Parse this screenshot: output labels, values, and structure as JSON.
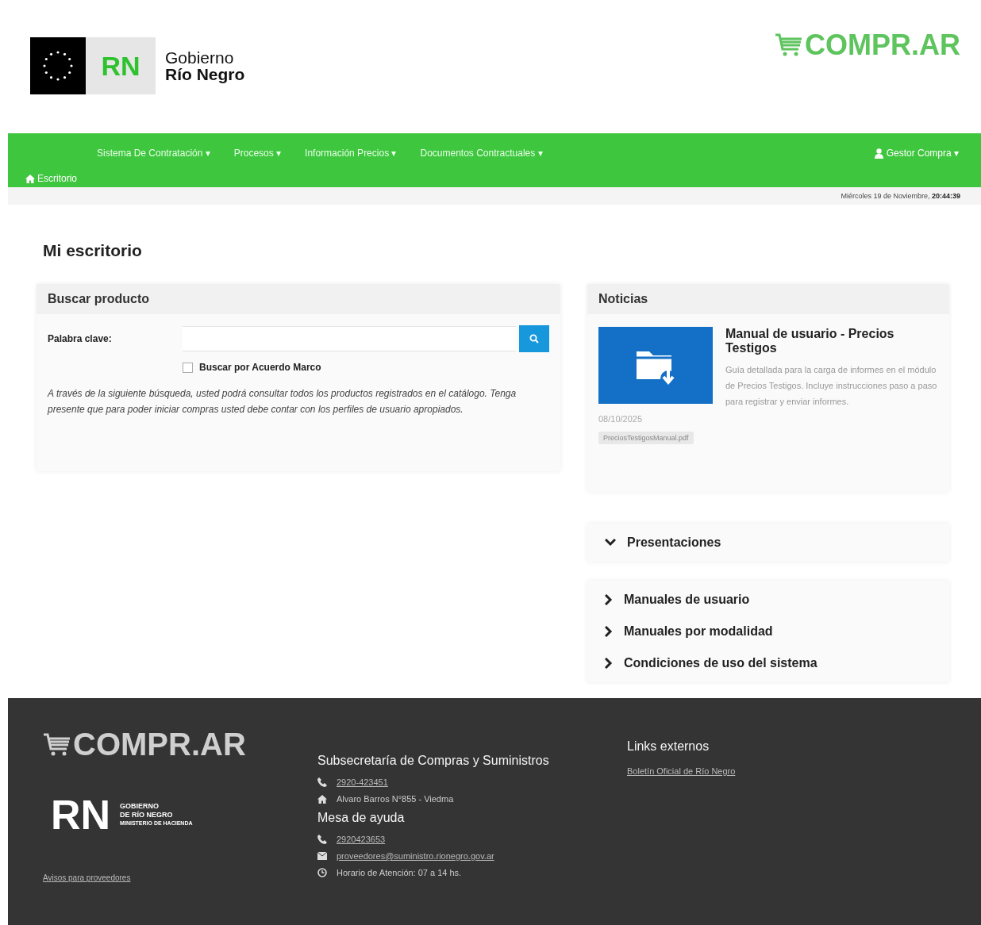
{
  "header": {
    "logo_mark": "RN",
    "logo_line1": "Gobierno",
    "logo_line2": "Río Negro",
    "brand": "COMPR.AR"
  },
  "navbar": {
    "items": [
      {
        "label": "Sistema De Contratación",
        "caret": "▾"
      },
      {
        "label": "Procesos",
        "caret": "▾"
      },
      {
        "label": "Información Precios",
        "caret": "▾"
      },
      {
        "label": "Documentos Contractuales",
        "caret": "▾"
      }
    ],
    "user": {
      "label": "Gestor Compra",
      "caret": "▾"
    },
    "breadcrumb": "Escritorio"
  },
  "datetime": {
    "date": "Miércoles 19 de Noviembre,",
    "time": "20:44:39"
  },
  "page_title": "Mi escritorio",
  "search_panel": {
    "title": "Buscar producto",
    "field_label": "Palabra clave:",
    "checkbox": {
      "label": "Buscar por Acuerdo Marco",
      "checked": false
    },
    "note": "A través de la siguiente búsqueda, usted podrá consultar todos los productos registrados en el catálogo. Tenga presente que para poder iniciar compras usted debe contar con los perfiles de usuario apropiados."
  },
  "news": {
    "title": "Noticias",
    "items": [
      {
        "title": "Manual de usuario - Precios Testigos",
        "body": "Guía detallada para la carga de informes en el módulo de Precios Testigos. Incluye instrucciones paso a paso para registrar y enviar informes.",
        "date": "08/10/2025",
        "attachment": "PreciosTestigosManual.pdf"
      }
    ]
  },
  "accordions": [
    {
      "label": "Presentaciones",
      "expanded": true
    },
    {
      "label": "Manuales de usuario",
      "expanded": false
    },
    {
      "label": "Manuales por modalidad",
      "expanded": false
    },
    {
      "label": "Condiciones de uso del sistema",
      "expanded": false
    }
  ],
  "footer": {
    "brand": "COMPR.AR",
    "logo_mark": "RN",
    "logo_line1": "GOBIERNO",
    "logo_line2": "DE RÍO NEGRO",
    "logo_line3": "MINISTERIO DE HACIENDA",
    "left_link": "Avisos para proveedores",
    "contacts": [
      {
        "title": "Subsecretaría de Compras y Suministros",
        "lines": [
          {
            "kind": "phone",
            "text": "2920-423451"
          },
          {
            "kind": "home",
            "text": "Alvaro Barros N°855 - Viedma"
          }
        ]
      },
      {
        "title": "Mesa de ayuda",
        "lines": [
          {
            "kind": "phone",
            "text": "2920423653"
          },
          {
            "kind": "mail",
            "text": "proveedores@suministro.rionegro.gov.ar"
          },
          {
            "kind": "clock",
            "text": "Horario de Atención: 07 a 14 hs."
          }
        ]
      }
    ],
    "links_title": "Links externos",
    "links": [
      "Boletín Oficial de Río Negro"
    ]
  }
}
